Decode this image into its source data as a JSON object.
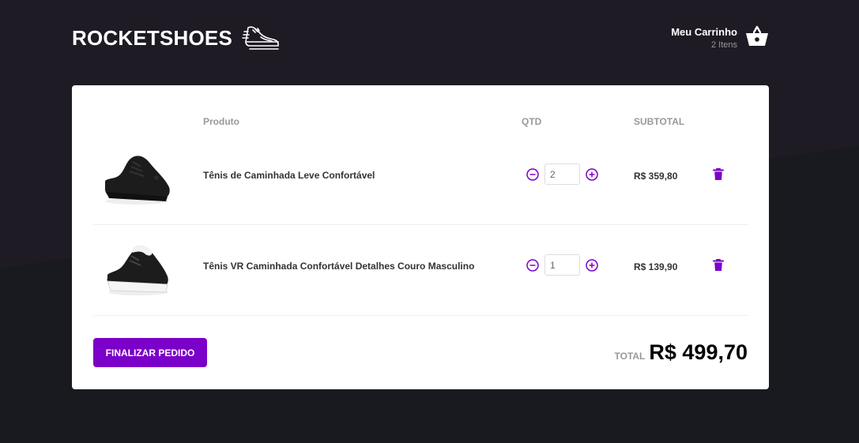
{
  "header": {
    "logo": "ROCKETSHOES",
    "logo_icon": "sneaker-icon",
    "cart_title": "Meu Carrinho",
    "cart_count": "2 Itens",
    "cart_icon": "basket-icon"
  },
  "table": {
    "headers": {
      "product": "Produto",
      "qty": "QTD",
      "subtotal": "SUBTOTAL"
    },
    "items": [
      {
        "title": "Tênis de Caminhada Leve Confortável",
        "quantity": "2",
        "subtotal": "R$ 359,80",
        "image": "black-sneaker-image"
      },
      {
        "title": "Tênis VR Caminhada Confortável Detalhes Couro Masculino",
        "quantity": "1",
        "subtotal": "R$ 139,90",
        "image": "black-white-sneaker-image"
      }
    ]
  },
  "footer": {
    "checkout_label": "FINALIZAR PEDIDO",
    "total_label": "TOTAL",
    "total_value": "R$ 499,70"
  },
  "colors": {
    "background": "#191920",
    "accent": "#7b00c9",
    "card": "#ffffff"
  }
}
